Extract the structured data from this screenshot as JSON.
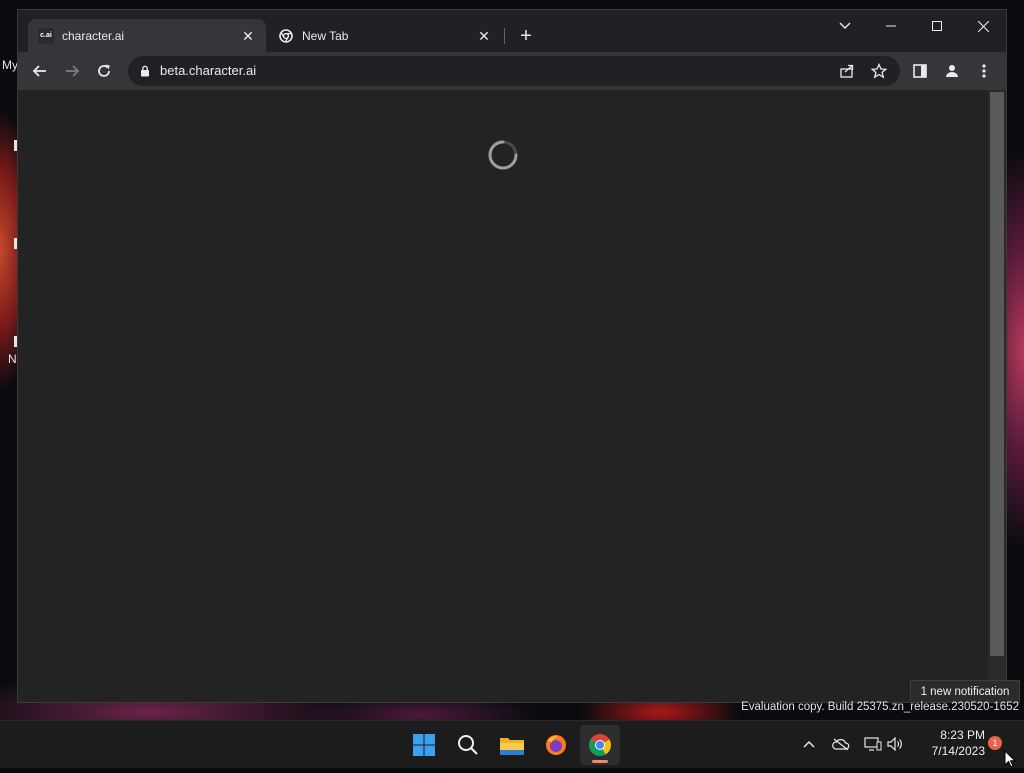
{
  "desktop": {
    "fragments": [
      "My",
      "N"
    ]
  },
  "browser": {
    "tabs": [
      {
        "title": "character.ai",
        "favicon_text": "c.ai",
        "active": true
      },
      {
        "title": "New Tab",
        "favicon": "chrome-icon",
        "active": false
      }
    ],
    "url": "beta.character.ai",
    "page_state": "loading"
  },
  "watermark": "Evaluation copy. Build 25375.zn_release.230520-1652",
  "toast": "1 new notification",
  "taskbar": {
    "apps": [
      "start",
      "search",
      "file-explorer",
      "firefox",
      "chrome"
    ],
    "active_app": "chrome",
    "clock_time": "8:23 PM",
    "clock_date": "7/14/2023",
    "notification_count": "1"
  },
  "colors": {
    "window_bg": "#202124",
    "toolbar_bg": "#35363a",
    "content_bg": "#232323",
    "taskbar_bg": "#1c1c1c",
    "accent": "#e8634a"
  }
}
